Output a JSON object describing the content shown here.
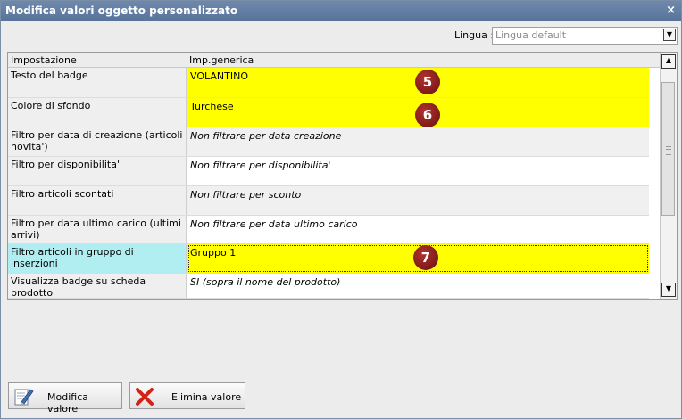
{
  "window": {
    "title": "Modifica valori oggetto personalizzato",
    "close_glyph": "×"
  },
  "language": {
    "label": "Lingua :",
    "value": "Lingua default"
  },
  "grid": {
    "headers": [
      "Impostazione",
      "Imp.generica"
    ],
    "rows": [
      {
        "setting": "Testo del badge",
        "value": "VOLANTINO",
        "style": "yellow"
      },
      {
        "setting": "Colore di sfondo",
        "value": "Turchese",
        "style": "yellow"
      },
      {
        "setting": "Filtro per data di creazione (articoli novita')",
        "value": "Non filtrare per data creazione",
        "style": "grey"
      },
      {
        "setting": "Filtro per disponibilita'",
        "value": "Non filtrare per disponibilita'",
        "style": "white"
      },
      {
        "setting": "Filtro articoli scontati",
        "value": "Non filtrare per sconto",
        "style": "grey"
      },
      {
        "setting": "Filtro per data ultimo carico (ultimi arrivi)",
        "value": "Non filtrare per data ultimo carico",
        "style": "white"
      },
      {
        "setting": "Filtro articoli in gruppo di inserzioni",
        "value": "Gruppo 1",
        "style": "sel"
      },
      {
        "setting": "Visualizza badge su scheda prodotto",
        "value": "SI (sopra il nome del prodotto)",
        "style": "white"
      }
    ]
  },
  "markers": [
    "5",
    "6",
    "7"
  ],
  "buttons": {
    "edit": "Modifica valore",
    "delete": "Elimina valore"
  },
  "icons": {
    "edit": "pencil-document-icon",
    "delete": "red-x-icon"
  },
  "colors": {
    "highlight": "#ffff00",
    "selected_label": "#b0eef2",
    "badge": "#8b1a1a",
    "titlebar": "#6380a6"
  }
}
